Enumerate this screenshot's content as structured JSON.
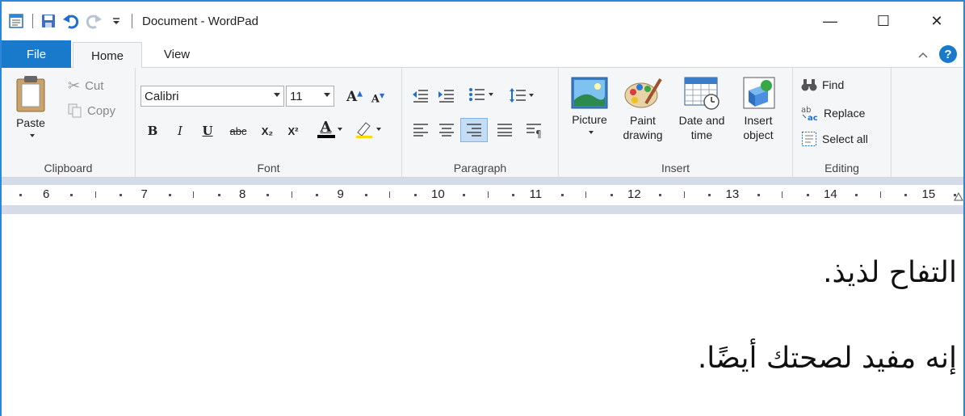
{
  "window": {
    "title": "Document - WordPad",
    "accent": "#1979ca",
    "border": "#2b88d8"
  },
  "quick_access": {
    "icons": [
      "wordpad-icon",
      "save-icon",
      "undo-icon",
      "redo-icon",
      "customize-icon"
    ]
  },
  "window_controls": {
    "minimize": "—",
    "maximize": "☐",
    "close": "✕"
  },
  "tabs": {
    "file": "File",
    "home": "Home",
    "view": "View",
    "collapse": "^",
    "help": "?"
  },
  "clipboard": {
    "paste": "Paste",
    "cut": "Cut",
    "copy": "Copy",
    "label": "Clipboard"
  },
  "font": {
    "family": "Calibri",
    "size": "11",
    "label": "Font",
    "bold": "B",
    "italic": "I",
    "underline": "U",
    "strikethrough": "abc",
    "subscript": "X₂",
    "superscript": "X²",
    "color_letter": "A",
    "font_color": "#000000",
    "highlight_color": "#ffd800"
  },
  "paragraph": {
    "label": "Paragraph"
  },
  "insert": {
    "picture": "Picture",
    "paint_line1": "Paint",
    "paint_line2": "drawing",
    "datetime_line1": "Date and",
    "datetime_line2": "time",
    "object_line1": "Insert",
    "object_line2": "object",
    "label": "Insert"
  },
  "editing": {
    "find": "Find",
    "replace": "Replace",
    "select_all": "Select all",
    "label": "Editing"
  },
  "ruler": {
    "numbers": [
      "6",
      "7",
      "8",
      "9",
      "10",
      "11",
      "12",
      "13",
      "14",
      "15"
    ]
  },
  "document": {
    "lines": [
      "التفاح لذيذ.",
      "إنه مفيد لصحتك أيضًا."
    ]
  }
}
